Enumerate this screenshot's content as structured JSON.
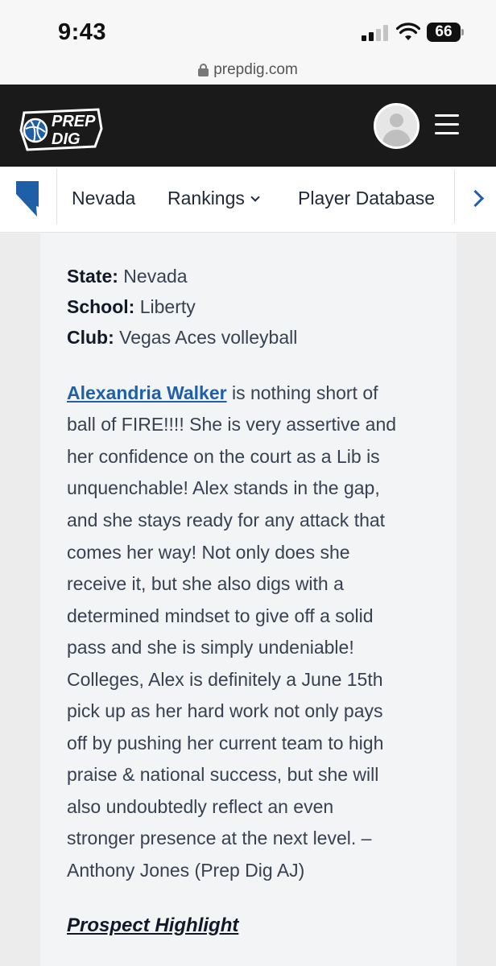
{
  "status_bar": {
    "time": "9:43",
    "battery": "66"
  },
  "browser": {
    "url": "prepdig.com"
  },
  "header": {
    "logo_line1": "PREP",
    "logo_line2": "DIG",
    "avatar": "user-avatar",
    "menu": "hamburger-menu-icon"
  },
  "nav": {
    "state_icon": "nevada-state-icon",
    "items": [
      {
        "label": "Nevada"
      },
      {
        "label": "Rankings"
      },
      {
        "label": "Player Database"
      }
    ]
  },
  "profile": {
    "state_label": "State:",
    "state_value": "Nevada",
    "school_label": "School:",
    "school_value": "Liberty",
    "club_label": "Club:",
    "club_value": "Vegas Aces volleyball"
  },
  "article": {
    "player_name": "Alexandria Walker",
    "first_line_rest": " is nothing short of",
    "lines": [
      "ball of FIRE!!!! She is very assertive and",
      "her confidence on the court as a Lib is",
      "unquenchable! Alex stands in the gap,",
      "and she stays ready for any attack that",
      "comes her way! Not only does she",
      "receive it, but she also digs with a",
      "determined mindset to give off a solid",
      "pass and she is simply undeniable!",
      "Colleges, Alex is definitely a June 15th",
      "pick up as her hard work not only pays",
      "off by pushing her current team to high",
      "praise & national success, but she will",
      "also undoubtedly reflect an even",
      "stronger presence at the next level. –",
      "Anthony Jones (Prep Dig AJ)"
    ],
    "highlight_heading": "Prospect Highlight"
  },
  "colors": {
    "header_bg": "#1a1a1a",
    "link": "#1f5fa8",
    "state_icon": "#1f5fa8",
    "content_bg": "#f3f4f6"
  }
}
